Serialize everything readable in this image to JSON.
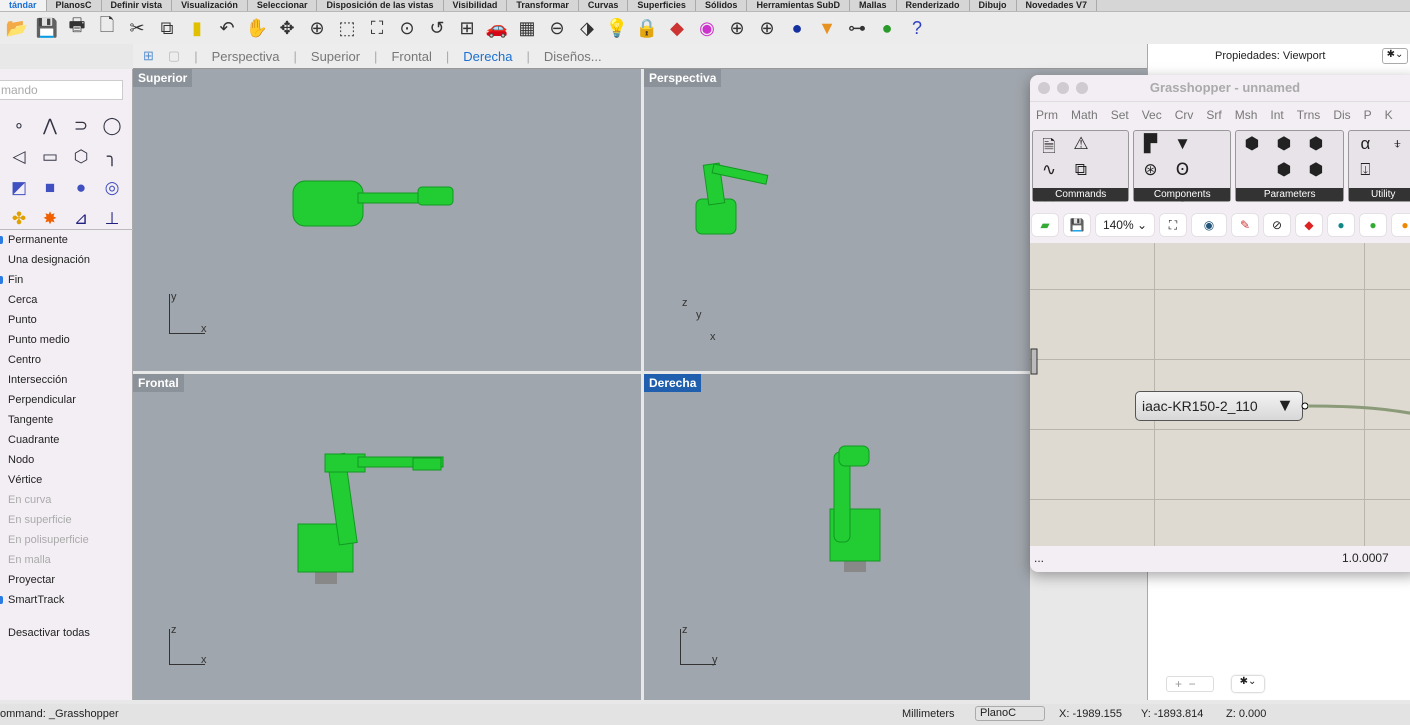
{
  "menu_tabs": [
    "tándar",
    "PlanosC",
    "Definir vista",
    "Visualización",
    "Seleccionar",
    "Disposición de las vistas",
    "Visibilidad",
    "Transformar",
    "Curvas",
    "Superficies",
    "Sólidos",
    "Herramientas SubD",
    "Mallas",
    "Renderizado",
    "Dibujo",
    "Novedades V7"
  ],
  "view_tabs": {
    "perspectiva": "Perspectiva",
    "superior": "Superior",
    "frontal": "Frontal",
    "derecha": "Derecha",
    "disenos": "Diseños..."
  },
  "command_placeholder": "mando",
  "osnaps": [
    {
      "label": "Permanente",
      "state": "checked"
    },
    {
      "label": "Una designación",
      "state": "off"
    },
    {
      "label": "Fin",
      "state": "checked"
    },
    {
      "label": "Cerca",
      "state": "off"
    },
    {
      "label": "Punto",
      "state": "off"
    },
    {
      "label": "Punto medio",
      "state": "off"
    },
    {
      "label": "Centro",
      "state": "off"
    },
    {
      "label": "Intersección",
      "state": "off"
    },
    {
      "label": "Perpendicular",
      "state": "off"
    },
    {
      "label": "Tangente",
      "state": "off"
    },
    {
      "label": "Cuadrante",
      "state": "off"
    },
    {
      "label": "Nodo",
      "state": "off"
    },
    {
      "label": "Vértice",
      "state": "off"
    },
    {
      "label": "En curva",
      "state": "disabled"
    },
    {
      "label": "En superficie",
      "state": "disabled"
    },
    {
      "label": "En polisuperficie",
      "state": "disabled"
    },
    {
      "label": "En malla",
      "state": "disabled"
    },
    {
      "label": "Proyectar",
      "state": "off"
    },
    {
      "label": "SmartTrack",
      "state": "checked"
    }
  ],
  "disable_all": "Desactivar todas",
  "viewports": {
    "top": "Superior",
    "perspective": "Perspectiva",
    "front": "Frontal",
    "right": "Derecha"
  },
  "axes": {
    "x": "x",
    "y": "y",
    "z": "z"
  },
  "properties_title": "Propiedades: Viewport",
  "grasshopper": {
    "title": "Grasshopper - unnamed",
    "tabs": [
      "Prm",
      "Math",
      "Set",
      "Vec",
      "Crv",
      "Srf",
      "Msh",
      "Int",
      "Trns",
      "Dis",
      "P",
      "K"
    ],
    "groups": [
      "Commands",
      "Components",
      "Parameters",
      "Utility"
    ],
    "zoom": "140%",
    "node_label": "iaac-KR150-2_110",
    "status_left": "...",
    "version": "1.0.0007"
  },
  "status": {
    "command": "ommand: _Grasshopper",
    "units": "Millimeters",
    "cplane": "PlanoC",
    "x": "X: -1989.155",
    "y": "Y: -1893.814",
    "z": "Z: 0.000"
  }
}
